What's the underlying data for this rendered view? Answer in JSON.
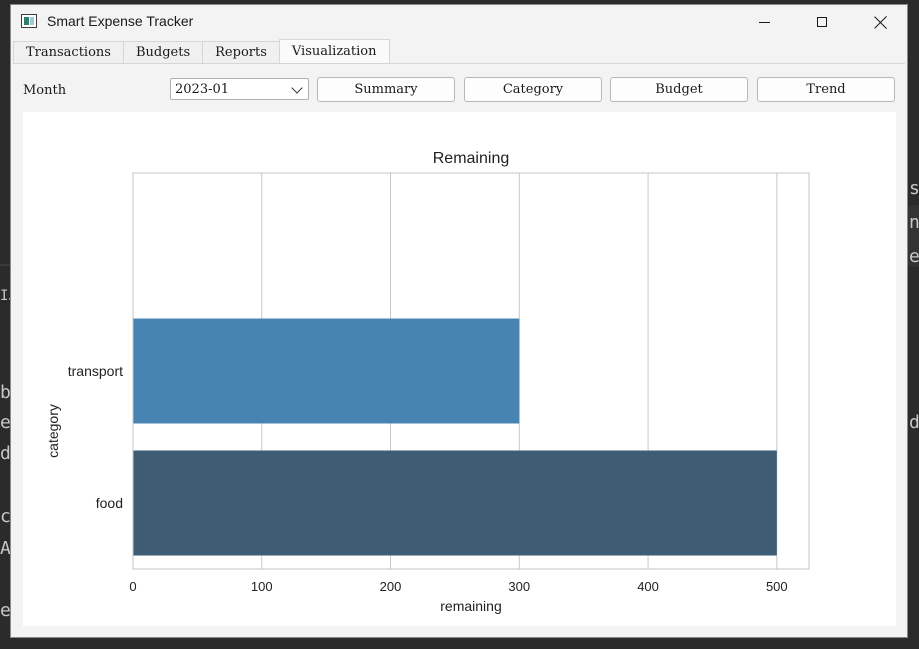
{
  "window": {
    "title": "Smart Expense Tracker"
  },
  "tabs": [
    {
      "label": "Transactions"
    },
    {
      "label": "Budgets"
    },
    {
      "label": "Reports"
    },
    {
      "label": "Visualization",
      "active": true
    }
  ],
  "toolbar": {
    "month_label": "Month",
    "month_value": "2023-01",
    "buttons": {
      "summary": "Summary",
      "category": "Category",
      "budget": "Budget",
      "trend": "Trend"
    }
  },
  "chart_data": {
    "type": "bar",
    "orientation": "horizontal",
    "title": "Remaining",
    "xlabel": "remaining",
    "ylabel": "category",
    "categories": [
      "transport",
      "food"
    ],
    "values": [
      300,
      500
    ],
    "colors": [
      "#4884b2",
      "#3e5c73"
    ],
    "xlim": [
      0,
      525
    ],
    "xticks": [
      "0",
      "100",
      "200",
      "300",
      "400",
      "500"
    ],
    "grid": "vertical",
    "legend": "none"
  },
  "background": {
    "fragments": [
      "s",
      "n",
      "e",
      "ba",
      "e",
      "dc",
      "cr",
      "Al",
      "er",
      "IJ",
      "de"
    ]
  }
}
